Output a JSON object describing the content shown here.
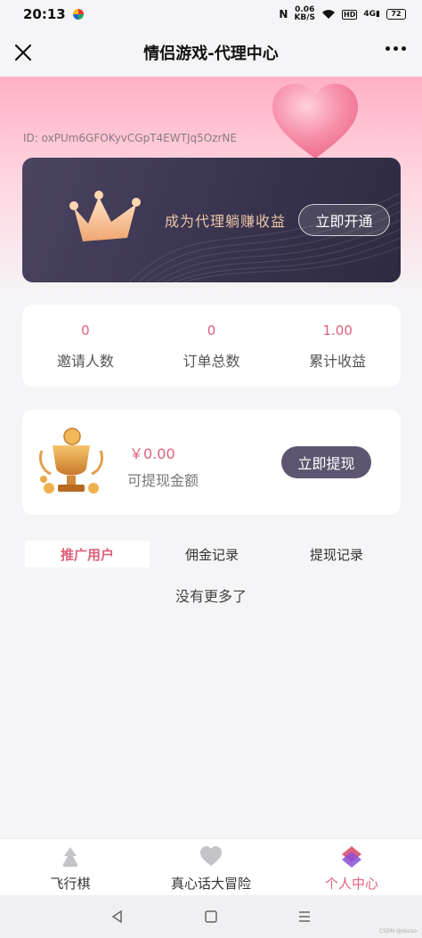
{
  "status_bar": {
    "time": "20:13",
    "speed_value": "0.06",
    "speed_unit": "KB/S",
    "hd": "HD",
    "signal": "4G",
    "battery": "72"
  },
  "nav": {
    "title": "情侣游戏-代理中心"
  },
  "user": {
    "id_text": "ID: oxPUm6GFOKyvCGpT4EWTJq5OzrNE"
  },
  "vip": {
    "text": "成为代理躺赚收益",
    "button": "立即开通"
  },
  "stats": [
    {
      "value": "0",
      "label": "邀请人数"
    },
    {
      "value": "0",
      "label": "订单总数"
    },
    {
      "value": "1.00",
      "label": "累计收益"
    }
  ],
  "wallet": {
    "amount": "￥0.00",
    "label": "可提现金额",
    "button": "立即提现"
  },
  "tabs": [
    {
      "label": "推广用户",
      "active": true
    },
    {
      "label": "佣金记录",
      "active": false
    },
    {
      "label": "提现记录",
      "active": false
    }
  ],
  "empty_message": "没有更多了",
  "bottom_nav": [
    {
      "label": "飞行棋",
      "icon": "chess-piece-icon"
    },
    {
      "label": "真心话大冒险",
      "icon": "heart-icon"
    },
    {
      "label": "个人中心",
      "icon": "layers-icon",
      "active": true
    }
  ],
  "watermark": "CSDN @dscso",
  "colors": {
    "accent": "#e0607a",
    "card_dark": "#3a3550",
    "header_pink": "#ffb0c5"
  }
}
